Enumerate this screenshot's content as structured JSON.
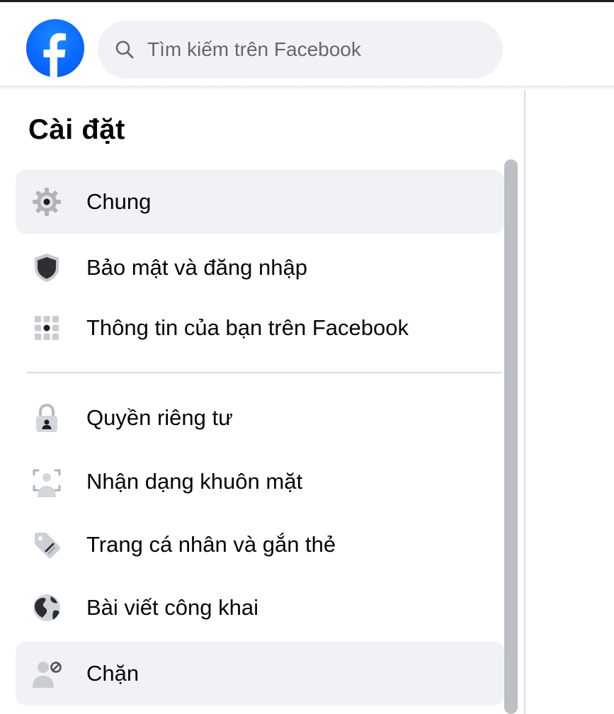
{
  "search": {
    "placeholder": "Tìm kiếm trên Facebook"
  },
  "sidebar": {
    "title": "Cài đặt",
    "items": [
      {
        "label": "Chung",
        "icon": "gear-icon",
        "active": true
      },
      {
        "label": "Bảo mật và đăng nhập",
        "icon": "shield-icon",
        "active": false
      },
      {
        "label": "Thông tin của bạn trên Facebook",
        "icon": "grid-icon",
        "active": false
      },
      {
        "label": "Quyền riêng tư",
        "icon": "lock-icon",
        "active": false
      },
      {
        "label": "Nhận dạng khuôn mặt",
        "icon": "face-recognition-icon",
        "active": false
      },
      {
        "label": "Trang cá nhân và gắn thẻ",
        "icon": "tag-icon",
        "active": false
      },
      {
        "label": "Bài viết công khai",
        "icon": "globe-icon",
        "active": false
      },
      {
        "label": "Chặn",
        "icon": "block-user-icon",
        "active": true
      }
    ]
  },
  "colors": {
    "brand": "#0866ff",
    "active_bg": "#f0f2f5",
    "icon_gray": "#8a8d91",
    "text": "#050505"
  }
}
